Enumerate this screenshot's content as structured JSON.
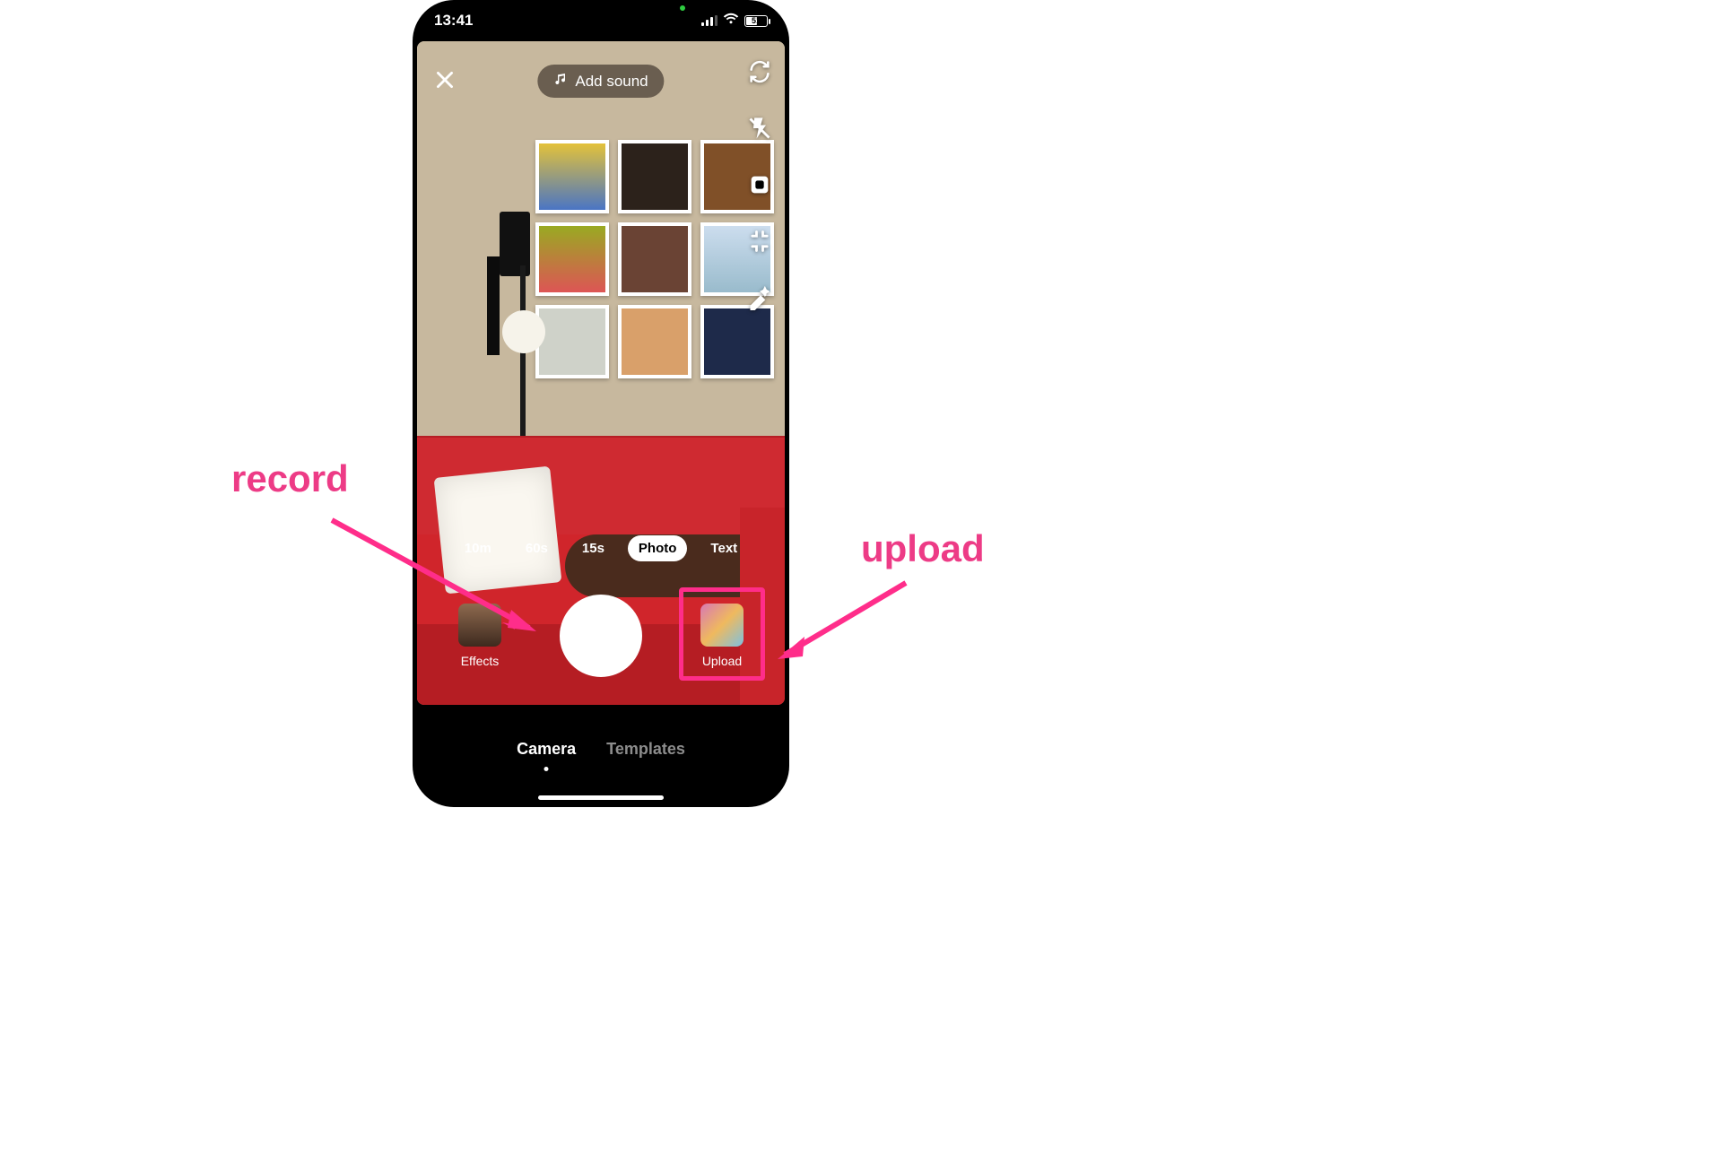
{
  "statusbar": {
    "time": "13:41",
    "battery_pct": "51"
  },
  "top": {
    "add_sound_label": "Add sound"
  },
  "durations": {
    "items": [
      "10m",
      "60s",
      "15s",
      "Photo",
      "Text"
    ],
    "active_index": 3
  },
  "bottom": {
    "effects_label": "Effects",
    "upload_label": "Upload"
  },
  "tabs": {
    "items": [
      "Camera",
      "Templates"
    ],
    "active_index": 0
  },
  "annotations": {
    "record": "record",
    "upload": "upload"
  },
  "colors": {
    "accent_pink": "#ff2d8a",
    "couch_red": "#d0252b"
  }
}
